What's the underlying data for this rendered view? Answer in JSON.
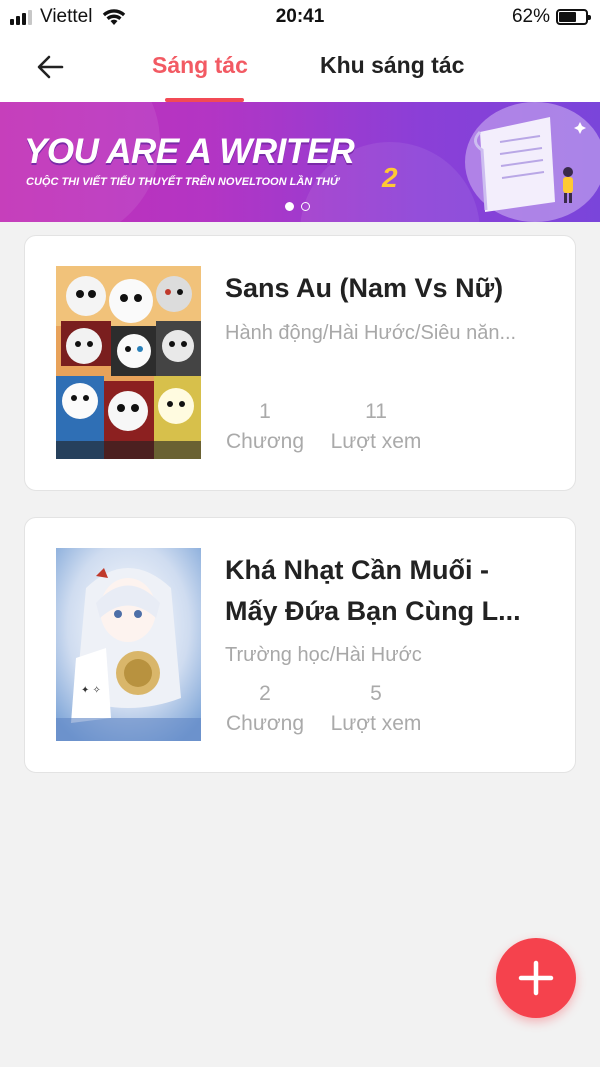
{
  "status_bar": {
    "carrier": "Viettel",
    "time": "20:41",
    "battery_percent": "62%"
  },
  "header": {
    "tabs": [
      {
        "label": "Sáng tác",
        "active": true
      },
      {
        "label": "Khu sáng tác",
        "active": false
      }
    ]
  },
  "banner": {
    "title": "YOU ARE A WRITER",
    "subtitle": "CUỘC THI VIẾT TIỂU THUYẾT TRÊN NOVELTOON LẦN THỨ",
    "number": "2",
    "active_slide": 1,
    "slide_count": 2
  },
  "works": [
    {
      "title_lines": [
        "Sans Au (Nam Vs Nữ)"
      ],
      "genres": "Hành động/Hài Hước/Siêu năn...",
      "chapters": "1",
      "chapters_label": "Chương",
      "views": "11",
      "views_label": "Lượt xem"
    },
    {
      "title_lines": [
        "Khá Nhạt Cần Muối -",
        "Mấy Đứa Bạn Cùng L..."
      ],
      "genres": "Trường học/Hài Hước",
      "chapters": "2",
      "chapters_label": "Chương",
      "views": "5",
      "views_label": "Lượt xem"
    }
  ],
  "colors": {
    "accent": "#f25a63",
    "fab": "#f5424d",
    "banner_start": "#c22fb6",
    "banner_end": "#7a45da",
    "banner_number": "#ffc933"
  },
  "icons": {
    "back": "arrow-left-icon",
    "fab": "plus-icon"
  }
}
